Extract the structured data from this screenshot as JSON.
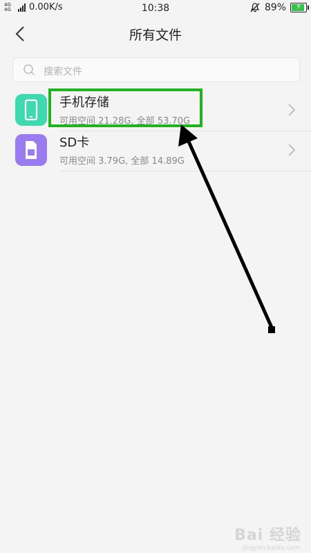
{
  "status_bar": {
    "network_badge": "4G 4G",
    "speed": "0.00K/s",
    "time": "10:38",
    "battery": "89%",
    "battery_level": 0.89
  },
  "header": {
    "title": "所有文件"
  },
  "search": {
    "placeholder": "搜索文件"
  },
  "storage_items": [
    {
      "title": "手机存储",
      "subtitle": "可用空间 21.28G, 全部 53.70G",
      "icon": "phone-icon",
      "icon_color": "#3fd9b0"
    },
    {
      "title": "SD卡",
      "subtitle": "可用空间 3.79G, 全部 14.89G",
      "icon": "sd-card-icon",
      "icon_color": "#9b7bf0"
    }
  ],
  "annotation": {
    "highlight_color": "#1fb31f",
    "arrow_color": "#000000"
  },
  "watermark": {
    "text": "Bai 经验",
    "sub": "jingyan.baidu.com"
  }
}
